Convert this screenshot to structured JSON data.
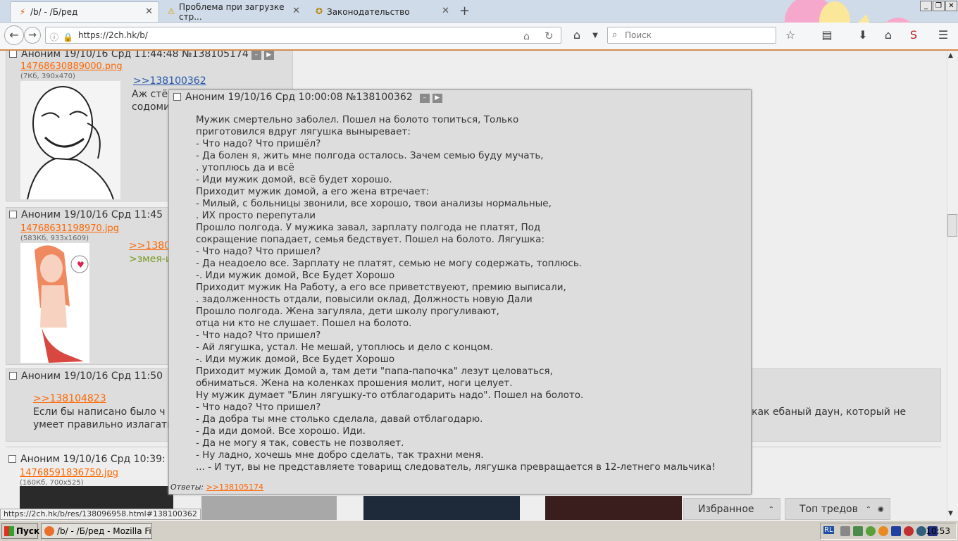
{
  "tabs": [
    {
      "title": "/b/ - /Б/ред",
      "icon": "lightning-icon"
    },
    {
      "title": "Проблема при загрузке стр...",
      "icon": "warning-icon"
    },
    {
      "title": "Законодательство",
      "icon": "emblem-icon"
    }
  ],
  "url": "https://2ch.hk/b/",
  "search_placeholder": "Поиск",
  "posts": [
    {
      "header": "Аноним 19/10/16 Срд 11:44:48  №138105174",
      "file": "14768630889000.png",
      "info": "(7Кб, 390x470)",
      "ref": ">>138100362",
      "lines": [
        "Аж стён",
        "содоми"
      ]
    },
    {
      "header": "Аноним 19/10/16 Срд 11:45",
      "file": "14768631198970.jpg",
      "info": "(583Кб, 933x1609)",
      "ref": ">>1380",
      "quote": ">змея-и"
    },
    {
      "header": "Аноним 19/10/16 Срд 11:50",
      "ref": ">>138104823",
      "lines": [
        "Если бы написано было ч",
        "умеет правильно излагать"
      ],
      "tail": "как ебаный даун, который не"
    },
    {
      "header": "Аноним 19/10/16 Срд 10:39:",
      "file": "14768591836750.jpg",
      "info": "(160Кб, 700x525)"
    }
  ],
  "popup": {
    "header": "Аноним 19/10/16 Срд 10:00:08  №138100362",
    "body": "Мужик смертельно заболел. Пошел на болото топиться, Только\nприготовился вдруг лягушка выныревает:\n- Что надо? Что пришёл?\n- Да болен я, жить мне полгода осталось. Зачем семью буду мучать,\n. утоплюсь да и всё\n- Иди мужик домой, всё будет хорошо.\nПриходит мужик домой, а его жена втречает:\n- Милый, с больницы звонили, все хорошо, твои анализы нормальные,\n. ИХ просто перепутали\nПрошло полгода. У мужика завал, зарплату полгода не платят, Под\nсокращение попадает, семья бедствует. Пошел на болото. Лягушка:\n- Что надо? Что пришел?\n- Да неадоело все. Зарплату не платят, семью не могу содержать, топлюсь.\n-. Иди мужик домой, Все Будет Хорошо\nПриходит мужик На Работу, а его все приветствуеют, премию выписали,\n. задолженность отдали, повысили оклад, Должность новую Дали\nПрошло полгода. Жена загуляла, дети школу прогуливают,\nотца ни кто не слушает. Пошел на болото.\n- Что надо? Что пришел?\n- Ай лягушка, устал. Не мешай, утоплюсь и дело с концом.\n-. Иди мужик домой, Все Будет Хорошо\nПриходит мужик Домой а, там дети \"папа-папочка\" лезут целоваться,\nобниматься. Жена на коленках прошения молит, ноги целует.\nНу мужик думает \"Блин лягушку-то отблагодарить надо\". Пошел на болото.\n- Что надо? Что пришел?\n- Да добра ты мне столько сделала, давай отблагодарю.\n- Да иди домой. Все хорошо. Иди.\n- Да не могу я так, совесть не позволяет.\n- Ну ладно, хочешь мне добро сделать, так трахни меня.\n... - И тут, вы не представляете товарищ следователь, лягушка превращается в 12-летнего мальчика!",
    "replies_label": "Ответы:",
    "reply_link": ">>138105174"
  },
  "panels": {
    "favorites": "Избранное",
    "top_threads": "Топ тредов"
  },
  "status_url": "https://2ch.hk/b/res/138096958.html#138100362",
  "taskbar": {
    "start": "Пуск",
    "window": "/b/ - /Б/ред - Mozilla Fire...",
    "clock": "10:53",
    "tray_lang": "RL"
  },
  "colors": {
    "accent": "#ff6600",
    "link": "#2255aa",
    "post_bg": "#dddddd",
    "page_bg": "#eeeeee"
  }
}
